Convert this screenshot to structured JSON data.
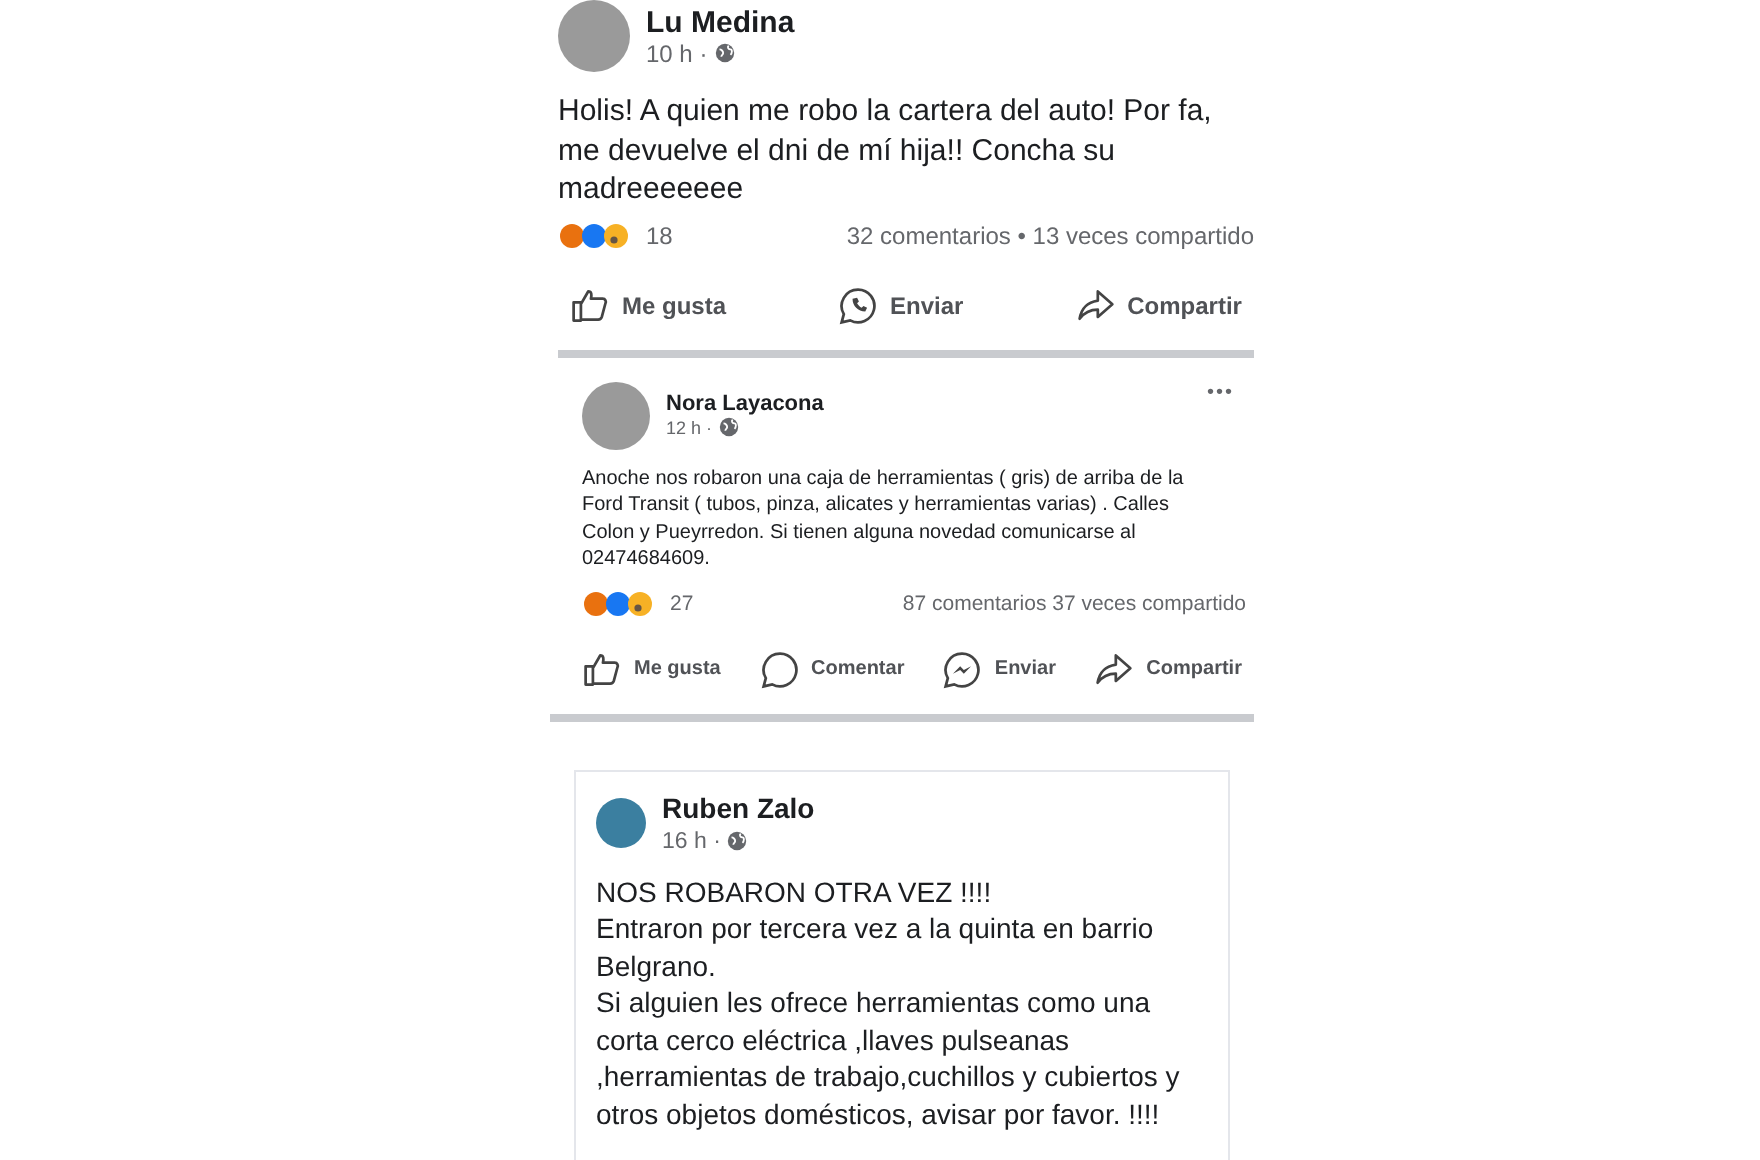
{
  "posts": [
    {
      "author": "Lu Medina",
      "time": "10 h ·",
      "body": [
        "Holis! A quien me robo la cartera del auto! Por fa, me devuelve el dni de mí hija!! Concha su madreeeeeee"
      ],
      "reaction_count": "18",
      "comments": "32 comentarios • 13 veces compartido",
      "actions": [
        {
          "kind": "like",
          "label": "Me gusta"
        },
        {
          "kind": "whatsapp",
          "label": "Enviar"
        },
        {
          "kind": "share",
          "label": "Compartir"
        }
      ]
    },
    {
      "author": "Nora Layacona",
      "time": "12 h ·",
      "menu": "•••",
      "body": [
        "Anoche nos robaron una caja de herramientas ( gris) de arriba de la Ford Transit ( tubos, pinza, alicates y herramientas varias) . Calles Colon y Pueyrredon. Si tienen alguna novedad comunicarse al 02474684609."
      ],
      "reaction_count": "27",
      "comments": "87 comentarios  37 veces compartido",
      "actions": [
        {
          "kind": "like",
          "label": "Me gusta"
        },
        {
          "kind": "comment",
          "label": "Comentar"
        },
        {
          "kind": "messenger",
          "label": "Enviar"
        },
        {
          "kind": "share",
          "label": "Compartir"
        }
      ]
    },
    {
      "author": "Ruben Zalo",
      "time": "16 h ·",
      "body": [
        "NOS ROBARON OTRA VEZ !!!!",
        "Entraron por tercera vez a la quinta en barrio Belgrano.",
        "Si alguien les ofrece herramientas  como una corta cerco eléctrica ,llaves pulseanas ,herramientas  de trabajo,cuchillos y cubiertos y otros objetos domésticos, avisar por favor. !!!!"
      ]
    }
  ]
}
